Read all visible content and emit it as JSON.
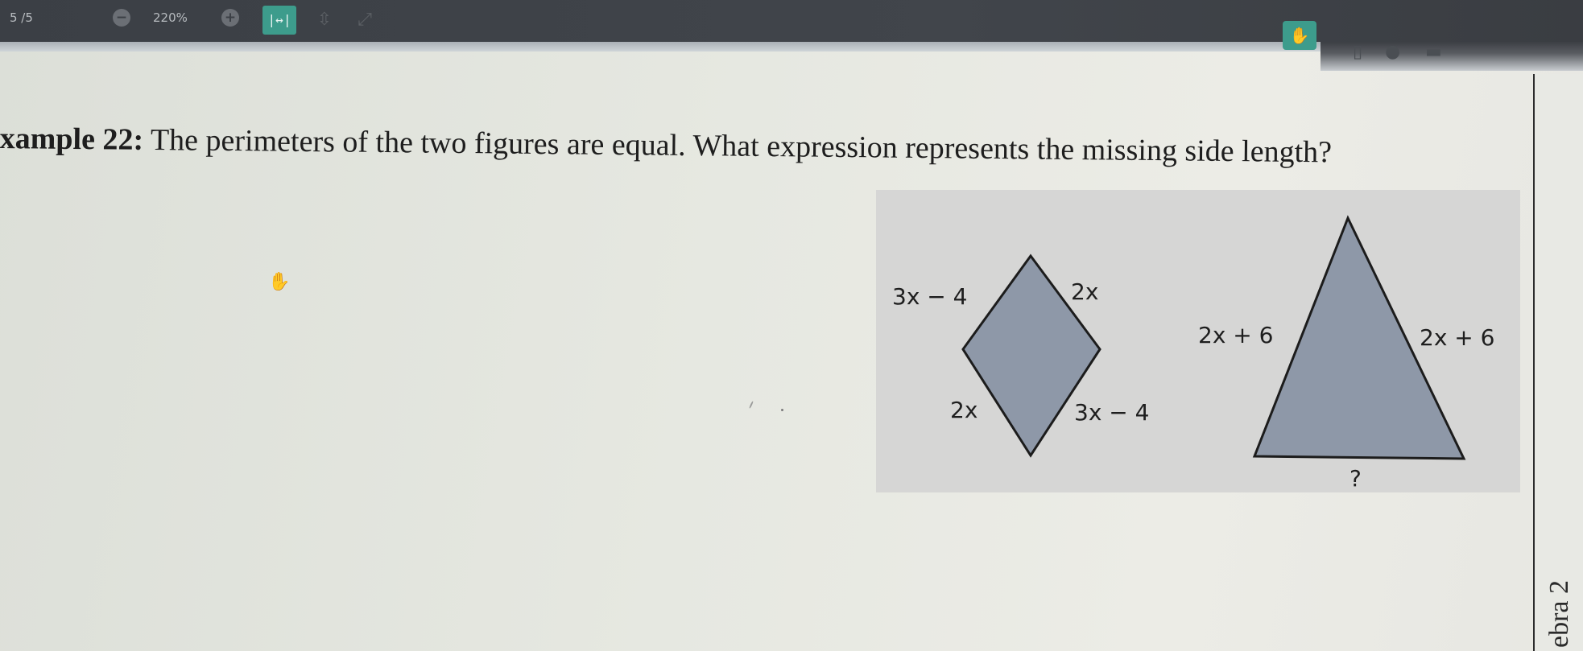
{
  "toolbar": {
    "page_indicator": "5 /5",
    "zoom_level": "220%",
    "zoom_out_icon": "minus-icon",
    "zoom_in_icon": "plus-icon",
    "fit_width_icon": "fit-width-icon",
    "fit_page_icon": "fit-page-icon",
    "fullscreen_icon": "fullscreen-icon",
    "hand_tool_icon": "hand-icon",
    "accent_color": "#3d9c8c"
  },
  "document": {
    "question_prefix": "xample 22:",
    "question_text": " The perimeters of the two figures are equal. What expression represents the missing side length?",
    "side_label": "ebra 2"
  },
  "figures": {
    "rhombus": {
      "top_left": "3x − 4",
      "top_right": "2x",
      "bottom_left": "2x",
      "bottom_right": "3x − 4"
    },
    "triangle": {
      "left": "2x + 6",
      "right": "2x + 6",
      "base": "?"
    },
    "shape_fill": "#8e98a8"
  }
}
